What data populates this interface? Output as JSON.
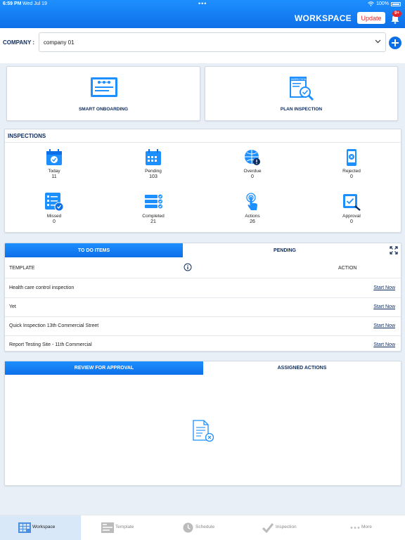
{
  "status_bar": {
    "time": "6:59 PM",
    "date": "Wed Jul 19",
    "battery": "100%"
  },
  "header": {
    "title": "WORKSPACE",
    "update_label": "Update",
    "notification_badge": "9+"
  },
  "company": {
    "label": "COMPANY :",
    "selected": "company 01"
  },
  "quick_actions": [
    {
      "label": "SMART ONBOARDING",
      "icon": "smart-onboarding-icon"
    },
    {
      "label": "PLAN INSPECTION",
      "icon": "plan-inspection-icon"
    }
  ],
  "inspections": {
    "title": "INSPECTIONS",
    "stats": [
      {
        "label": "Today",
        "value": "11",
        "icon": "calendar-check-icon"
      },
      {
        "label": "Pending",
        "value": "103",
        "icon": "calendar-grid-icon"
      },
      {
        "label": "Overdue",
        "value": "0",
        "icon": "globe-alert-icon"
      },
      {
        "label": "Rejected",
        "value": "0",
        "icon": "phone-reject-icon"
      },
      {
        "label": "Missed",
        "value": "0",
        "icon": "checklist-missed-icon"
      },
      {
        "label": "Completed",
        "value": "21",
        "icon": "checklist-complete-icon"
      },
      {
        "label": "Actions",
        "value": "26",
        "icon": "tap-hand-icon"
      },
      {
        "label": "Approval",
        "value": "0",
        "icon": "approval-icon"
      }
    ]
  },
  "todo": {
    "tabs": [
      "TO DO ITEMS",
      "PENDING"
    ],
    "col_template": "TEMPLATE",
    "col_action": "ACTION",
    "rows": [
      {
        "name": "Health care control inspection",
        "action": "Start Now"
      },
      {
        "name": "Yet",
        "action": "Start Now"
      },
      {
        "name": "Quick Inspection 13th Commercial Street",
        "action": "Start Now"
      },
      {
        "name": "Report Testing Site - 11th Commercial",
        "action": "Start Now"
      }
    ]
  },
  "review": {
    "tabs": [
      "REVIEW FOR APPROVAL",
      "ASSIGNED ACTIONS"
    ]
  },
  "bottom_nav": [
    {
      "label": "Workspace",
      "icon": "workspace-icon"
    },
    {
      "label": "Template",
      "icon": "template-icon"
    },
    {
      "label": "Schedule",
      "icon": "clock-icon"
    },
    {
      "label": "Inspection",
      "icon": "checkmark-icon"
    },
    {
      "label": "More",
      "icon": "more-dots-icon"
    }
  ],
  "colors": {
    "primary": "#0d6fe8",
    "accent_red": "#e5252a",
    "navy": "#0d2b5c"
  }
}
